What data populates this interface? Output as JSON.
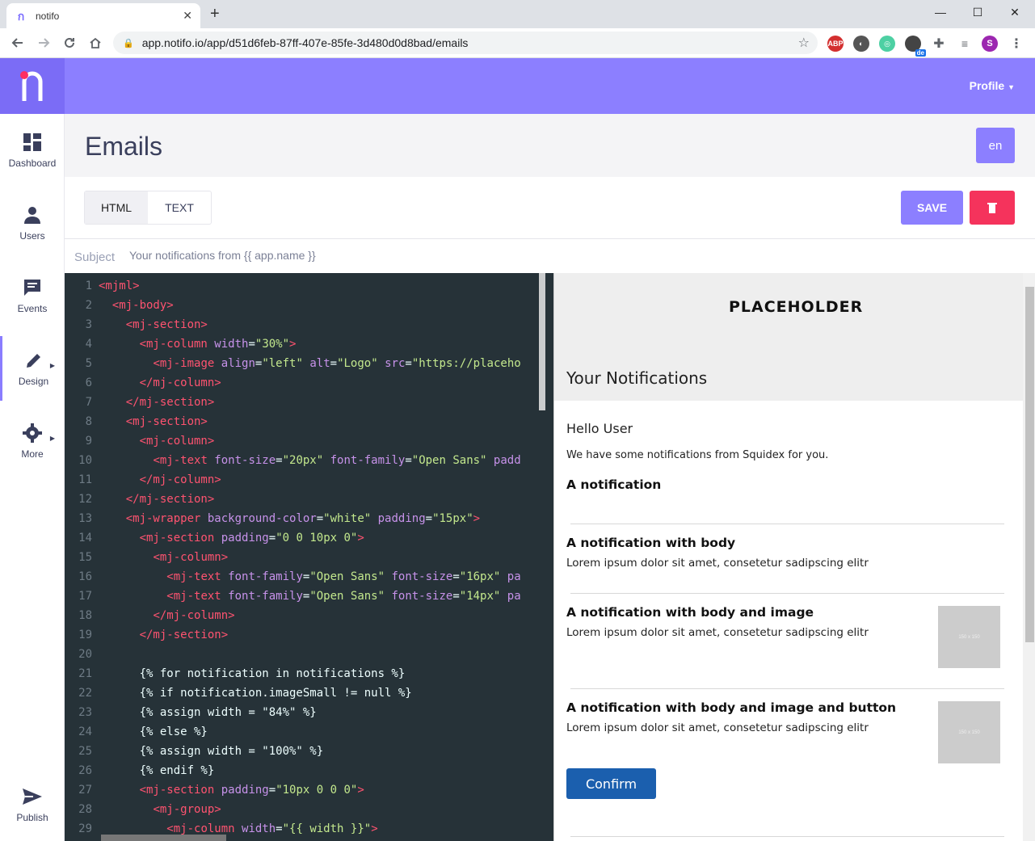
{
  "browser": {
    "tab_title": "notifo",
    "tab_close": "✕",
    "new_tab": "+",
    "url": "app.notifo.io/app/d51d6feb-87ff-407e-85fe-3d480d0d8bad/emails",
    "window_min": "—",
    "window_max": "☐",
    "window_close": "✕",
    "ext_abp": "ABP",
    "ext_lang_badge": "de",
    "profile_initial": "S"
  },
  "sidebar": {
    "items": [
      {
        "label": "Dashboard",
        "icon": "dashboard-icon"
      },
      {
        "label": "Users",
        "icon": "user-icon"
      },
      {
        "label": "Events",
        "icon": "message-icon"
      },
      {
        "label": "Design",
        "icon": "pencil-icon"
      },
      {
        "label": "More",
        "icon": "gear-icon"
      },
      {
        "label": "Publish",
        "icon": "send-icon"
      }
    ]
  },
  "header": {
    "profile_label": "Profile"
  },
  "page": {
    "title": "Emails",
    "language": "en"
  },
  "form": {
    "tabs": [
      "HTML",
      "TEXT"
    ],
    "active_tab": "HTML",
    "save_label": "SAVE",
    "subject_label": "Subject",
    "subject_value": "Your notifications from {{ app.name }}"
  },
  "editor": {
    "lines": [
      [
        1,
        [
          [
            "tg",
            "<mjml>"
          ]
        ]
      ],
      [
        2,
        [
          [
            "pl",
            "  "
          ],
          [
            "tg",
            "<mj-body>"
          ]
        ]
      ],
      [
        3,
        [
          [
            "pl",
            "    "
          ],
          [
            "tg",
            "<mj-section>"
          ]
        ]
      ],
      [
        4,
        [
          [
            "pl",
            "      "
          ],
          [
            "tg",
            "<mj-column "
          ],
          [
            "at",
            "width"
          ],
          [
            "pl",
            "="
          ],
          [
            "st",
            "\"30%\""
          ],
          [
            "tg",
            ">"
          ]
        ]
      ],
      [
        5,
        [
          [
            "pl",
            "        "
          ],
          [
            "tg",
            "<mj-image "
          ],
          [
            "at",
            "align"
          ],
          [
            "pl",
            "="
          ],
          [
            "st",
            "\"left\""
          ],
          [
            "pl",
            " "
          ],
          [
            "at",
            "alt"
          ],
          [
            "pl",
            "="
          ],
          [
            "st",
            "\"Logo\""
          ],
          [
            "pl",
            " "
          ],
          [
            "at",
            "src"
          ],
          [
            "pl",
            "="
          ],
          [
            "st",
            "\"https://placeho"
          ]
        ]
      ],
      [
        6,
        [
          [
            "pl",
            "      "
          ],
          [
            "tg",
            "</mj-column>"
          ]
        ]
      ],
      [
        7,
        [
          [
            "pl",
            "    "
          ],
          [
            "tg",
            "</mj-section>"
          ]
        ]
      ],
      [
        8,
        [
          [
            "pl",
            "    "
          ],
          [
            "tg",
            "<mj-section>"
          ]
        ]
      ],
      [
        9,
        [
          [
            "pl",
            "      "
          ],
          [
            "tg",
            "<mj-column>"
          ]
        ]
      ],
      [
        10,
        [
          [
            "pl",
            "        "
          ],
          [
            "tg",
            "<mj-text "
          ],
          [
            "at",
            "font-size"
          ],
          [
            "pl",
            "="
          ],
          [
            "st",
            "\"20px\""
          ],
          [
            "pl",
            " "
          ],
          [
            "at",
            "font-family"
          ],
          [
            "pl",
            "="
          ],
          [
            "st",
            "\"Open Sans\""
          ],
          [
            "pl",
            " "
          ],
          [
            "at",
            "padd"
          ]
        ]
      ],
      [
        11,
        [
          [
            "pl",
            "      "
          ],
          [
            "tg",
            "</mj-column>"
          ]
        ]
      ],
      [
        12,
        [
          [
            "pl",
            "    "
          ],
          [
            "tg",
            "</mj-section>"
          ]
        ]
      ],
      [
        13,
        [
          [
            "pl",
            "    "
          ],
          [
            "tg",
            "<mj-wrapper "
          ],
          [
            "at",
            "background-color"
          ],
          [
            "pl",
            "="
          ],
          [
            "st",
            "\"white\""
          ],
          [
            "pl",
            " "
          ],
          [
            "at",
            "padding"
          ],
          [
            "pl",
            "="
          ],
          [
            "st",
            "\"15px\""
          ],
          [
            "tg",
            ">"
          ]
        ]
      ],
      [
        14,
        [
          [
            "pl",
            "      "
          ],
          [
            "tg",
            "<mj-section "
          ],
          [
            "at",
            "padding"
          ],
          [
            "pl",
            "="
          ],
          [
            "st",
            "\"0 0 10px 0\""
          ],
          [
            "tg",
            ">"
          ]
        ]
      ],
      [
        15,
        [
          [
            "pl",
            "        "
          ],
          [
            "tg",
            "<mj-column>"
          ]
        ]
      ],
      [
        16,
        [
          [
            "pl",
            "          "
          ],
          [
            "tg",
            "<mj-text "
          ],
          [
            "at",
            "font-family"
          ],
          [
            "pl",
            "="
          ],
          [
            "st",
            "\"Open Sans\""
          ],
          [
            "pl",
            " "
          ],
          [
            "at",
            "font-size"
          ],
          [
            "pl",
            "="
          ],
          [
            "st",
            "\"16px\""
          ],
          [
            "pl",
            " "
          ],
          [
            "at",
            "pa"
          ]
        ]
      ],
      [
        17,
        [
          [
            "pl",
            "          "
          ],
          [
            "tg",
            "<mj-text "
          ],
          [
            "at",
            "font-family"
          ],
          [
            "pl",
            "="
          ],
          [
            "st",
            "\"Open Sans\""
          ],
          [
            "pl",
            " "
          ],
          [
            "at",
            "font-size"
          ],
          [
            "pl",
            "="
          ],
          [
            "st",
            "\"14px\""
          ],
          [
            "pl",
            " "
          ],
          [
            "at",
            "pa"
          ]
        ]
      ],
      [
        18,
        [
          [
            "pl",
            "        "
          ],
          [
            "tg",
            "</mj-column>"
          ]
        ]
      ],
      [
        19,
        [
          [
            "pl",
            "      "
          ],
          [
            "tg",
            "</mj-section>"
          ]
        ]
      ],
      [
        20,
        [
          [
            "pl",
            ""
          ]
        ]
      ],
      [
        21,
        [
          [
            "pl",
            "      {% for notification in notifications %}"
          ]
        ]
      ],
      [
        22,
        [
          [
            "pl",
            "      {% if notification.imageSmall != null %}"
          ]
        ]
      ],
      [
        23,
        [
          [
            "pl",
            "      {% assign width = \"84%\" %}"
          ]
        ]
      ],
      [
        24,
        [
          [
            "pl",
            "      {% else %}"
          ]
        ]
      ],
      [
        25,
        [
          [
            "pl",
            "      {% assign width = \"100%\" %}"
          ]
        ]
      ],
      [
        26,
        [
          [
            "pl",
            "      {% endif %}"
          ]
        ]
      ],
      [
        27,
        [
          [
            "pl",
            "      "
          ],
          [
            "tg",
            "<mj-section "
          ],
          [
            "at",
            "padding"
          ],
          [
            "pl",
            "="
          ],
          [
            "st",
            "\"10px 0 0 0\""
          ],
          [
            "tg",
            ">"
          ]
        ]
      ],
      [
        28,
        [
          [
            "pl",
            "        "
          ],
          [
            "tg",
            "<mj-group>"
          ]
        ]
      ],
      [
        29,
        [
          [
            "pl",
            "          "
          ],
          [
            "tg",
            "<mj-column "
          ],
          [
            "at",
            "width"
          ],
          [
            "pl",
            "="
          ],
          [
            "st",
            "\"{{ width }}\""
          ],
          [
            "tg",
            ">"
          ]
        ]
      ]
    ]
  },
  "preview": {
    "logo_text": "PLACEHOLDER",
    "heading": "Your Notifications",
    "greeting": "Hello User",
    "intro": "We have some notifications from Squidex for you.",
    "notifications": [
      {
        "title": "A notification",
        "body": ""
      },
      {
        "title": "A notification with body",
        "body": "Lorem ipsum dolor sit amet, consetetur sadipscing elitr"
      },
      {
        "title": "A notification with body and image",
        "body": "Lorem ipsum dolor sit amet, consetetur sadipscing elitr",
        "image_label": "150 x 150"
      },
      {
        "title": "A notification with body and image and button",
        "body": "Lorem ipsum dolor sit amet, consetetur sadipscing elitr",
        "image_label": "150 x 150"
      }
    ],
    "button_label": "Confirm"
  },
  "colors": {
    "accent": "#8c7fff",
    "danger": "#f5335c",
    "editor_bg": "#263238",
    "confirm": "#1b5fae"
  }
}
